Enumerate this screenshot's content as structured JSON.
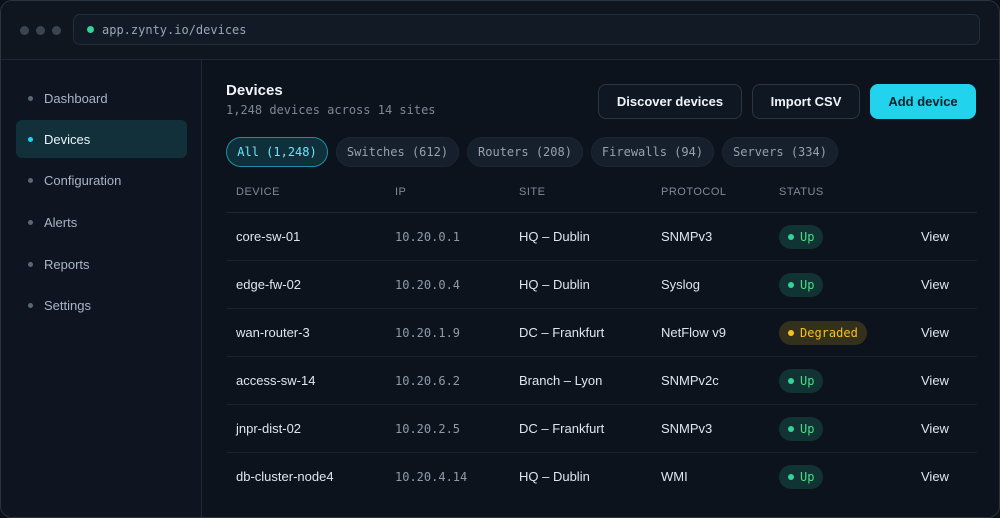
{
  "browser": {
    "url": "app.zynty.io/devices"
  },
  "sidebar": {
    "items": [
      {
        "label": "Dashboard"
      },
      {
        "label": "Devices"
      },
      {
        "label": "Configuration"
      },
      {
        "label": "Alerts"
      },
      {
        "label": "Reports"
      },
      {
        "label": "Settings"
      }
    ],
    "active": "Devices"
  },
  "header": {
    "title": "Devices",
    "subtitle": "1,248 devices across 14 sites",
    "discover_label": "Discover devices",
    "import_label": "Import CSV",
    "add_label": "Add device"
  },
  "filters": [
    {
      "label": "All (1,248)",
      "active": true
    },
    {
      "label": "Switches (612)"
    },
    {
      "label": "Routers (208)"
    },
    {
      "label": "Firewalls (94)"
    },
    {
      "label": "Servers (334)"
    }
  ],
  "table": {
    "columns": [
      "DEVICE",
      "IP",
      "SITE",
      "PROTOCOL",
      "STATUS"
    ],
    "rows": [
      {
        "device": "core-sw-01",
        "ip": "10.20.0.1",
        "site": "HQ – Dublin",
        "protocol": "SNMPv3",
        "status": "Up",
        "action": "View"
      },
      {
        "device": "edge-fw-02",
        "ip": "10.20.0.4",
        "site": "HQ – Dublin",
        "protocol": "Syslog",
        "status": "Up",
        "action": "View"
      },
      {
        "device": "wan-router-3",
        "ip": "10.20.1.9",
        "site": "DC – Frankfurt",
        "protocol": "NetFlow v9",
        "status": "Degraded",
        "action": "View"
      },
      {
        "device": "access-sw-14",
        "ip": "10.20.6.2",
        "site": "Branch – Lyon",
        "protocol": "SNMPv2c",
        "status": "Up",
        "action": "View"
      },
      {
        "device": "jnpr-dist-02",
        "ip": "10.20.2.5",
        "site": "DC – Frankfurt",
        "protocol": "SNMPv3",
        "status": "Up",
        "action": "View"
      },
      {
        "device": "db-cluster-node4",
        "ip": "10.20.4.14",
        "site": "HQ – Dublin",
        "protocol": "WMI",
        "status": "Up",
        "action": "View"
      }
    ]
  },
  "colors": {
    "accent": "#22d3ee",
    "status_up": "#34d399",
    "status_degraded": "#fbbf24"
  }
}
